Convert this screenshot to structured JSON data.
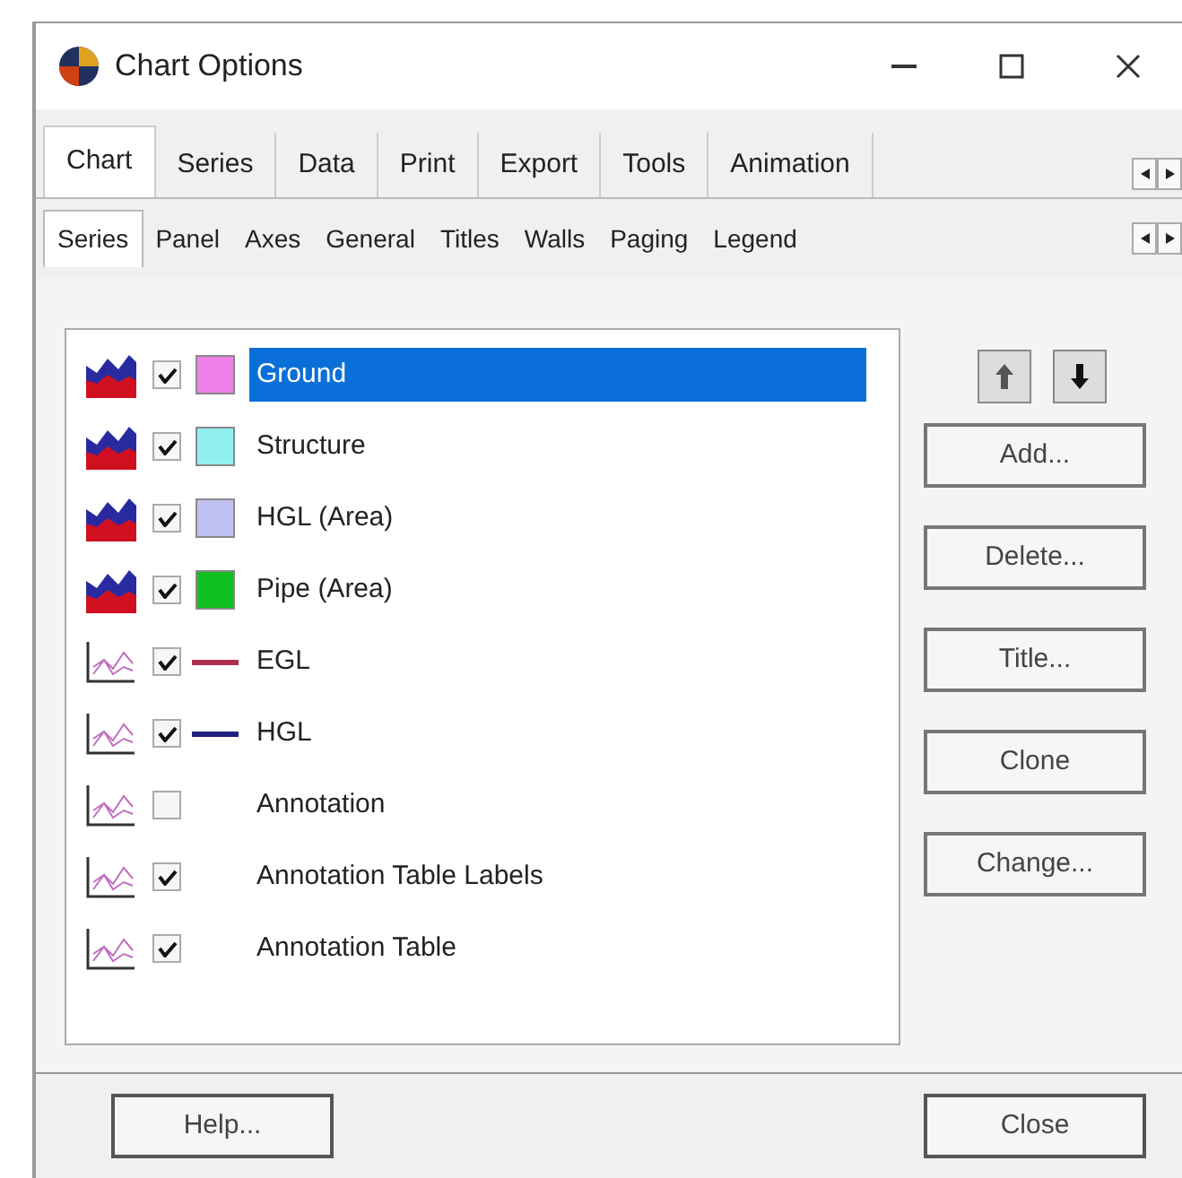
{
  "window": {
    "title": "Chart Options"
  },
  "tabs": [
    {
      "label": "Chart",
      "selected": true
    },
    {
      "label": "Series",
      "selected": false
    },
    {
      "label": "Data",
      "selected": false
    },
    {
      "label": "Print",
      "selected": false
    },
    {
      "label": "Export",
      "selected": false
    },
    {
      "label": "Tools",
      "selected": false
    },
    {
      "label": "Animation",
      "selected": false
    }
  ],
  "subtabs": [
    {
      "label": "Series",
      "selected": true
    },
    {
      "label": "Panel",
      "selected": false
    },
    {
      "label": "Axes",
      "selected": false
    },
    {
      "label": "General",
      "selected": false
    },
    {
      "label": "Titles",
      "selected": false
    },
    {
      "label": "Walls",
      "selected": false
    },
    {
      "label": "Paging",
      "selected": false
    },
    {
      "label": "Legend",
      "selected": false
    }
  ],
  "series": [
    {
      "name": "Ground",
      "kind": "area",
      "checked": true,
      "selected": true,
      "swatch": {
        "kind": "fill",
        "color": "#f080e8"
      }
    },
    {
      "name": "Structure",
      "kind": "area",
      "checked": true,
      "selected": false,
      "swatch": {
        "kind": "fill",
        "color": "#90f0f0"
      }
    },
    {
      "name": "HGL (Area)",
      "kind": "area",
      "checked": true,
      "selected": false,
      "swatch": {
        "kind": "fill",
        "color": "#c0c0f0"
      }
    },
    {
      "name": "Pipe (Area)",
      "kind": "area",
      "checked": true,
      "selected": false,
      "swatch": {
        "kind": "fill",
        "color": "#10c020"
      }
    },
    {
      "name": "EGL",
      "kind": "line",
      "checked": true,
      "selected": false,
      "swatch": {
        "kind": "line",
        "color": "#b03050"
      }
    },
    {
      "name": "HGL",
      "kind": "line",
      "checked": true,
      "selected": false,
      "swatch": {
        "kind": "line",
        "color": "#202080"
      }
    },
    {
      "name": "Annotation",
      "kind": "line",
      "checked": false,
      "selected": false
    },
    {
      "name": "Annotation Table Labels",
      "kind": "line",
      "checked": true,
      "selected": false
    },
    {
      "name": "Annotation Table",
      "kind": "line",
      "checked": true,
      "selected": false
    }
  ],
  "side_buttons": [
    "Add...",
    "Delete...",
    "Title...",
    "Clone",
    "Change..."
  ],
  "footer_buttons": [
    "Help...",
    "Close"
  ]
}
